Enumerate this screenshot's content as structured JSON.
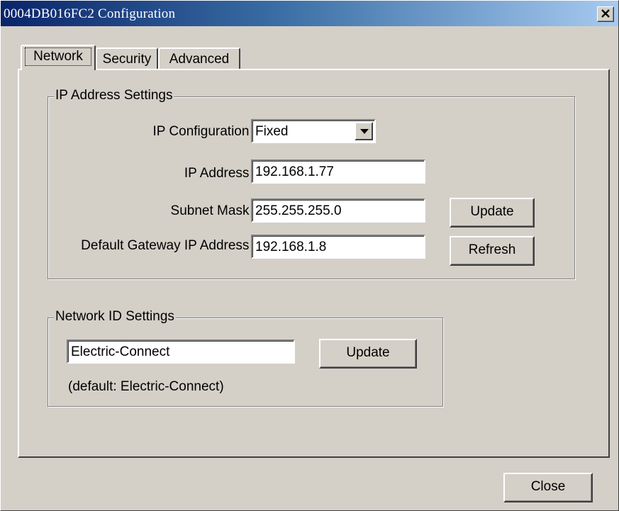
{
  "window": {
    "title": "0004DB016FC2  Configuration"
  },
  "tabs": [
    {
      "label": "Network",
      "active": true
    },
    {
      "label": "Security",
      "active": false
    },
    {
      "label": "Advanced",
      "active": false
    }
  ],
  "ip_settings": {
    "legend": "IP Address Settings",
    "ip_config_label": "IP Configuration :",
    "ip_config_value": "Fixed",
    "ip_address_label": "IP Address :",
    "ip_address_value": "192.168.1.77",
    "subnet_label": "Subnet Mask :",
    "subnet_value": "255.255.255.0",
    "gateway_label": "Default Gateway IP Address :",
    "gateway_value": "192.168.1.8",
    "update_label": "Update",
    "refresh_label": "Refresh"
  },
  "network_id": {
    "legend": "Network ID Settings",
    "value": "Electric-Connect",
    "update_label": "Update",
    "default_note": "(default: Electric-Connect)"
  },
  "footer": {
    "close_label": "Close"
  }
}
